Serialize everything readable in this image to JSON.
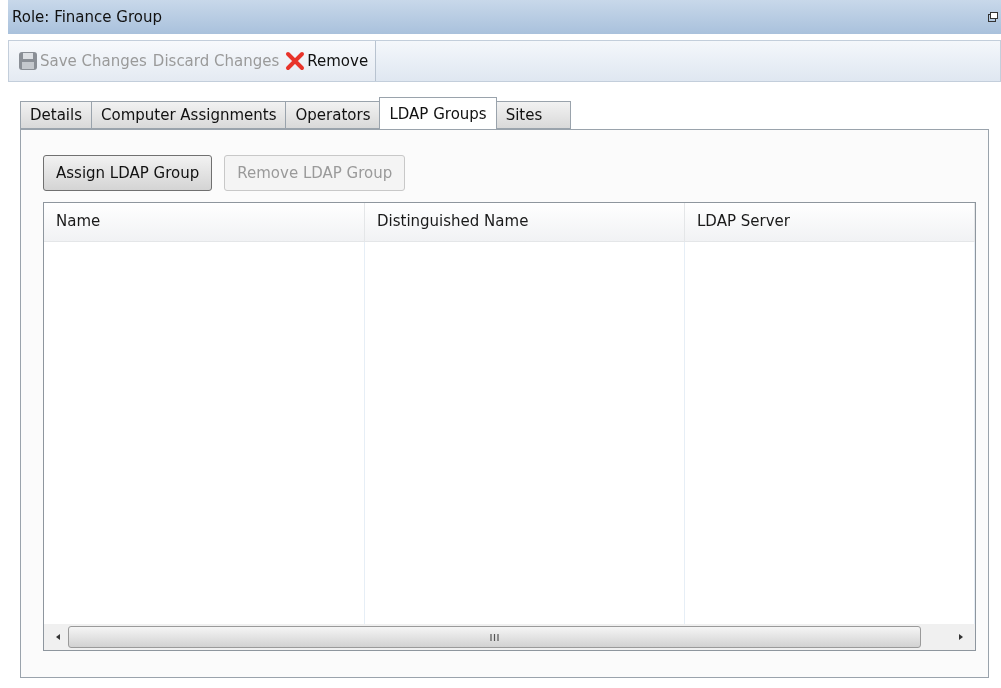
{
  "window": {
    "title": "Role: Finance Group"
  },
  "toolbar": [
    {
      "label": "Save Changes",
      "kind": "save",
      "disabled": true
    },
    {
      "label": "Discard Changes",
      "kind": "plain",
      "disabled": true
    },
    {
      "label": "Remove",
      "kind": "remove",
      "disabled": false
    }
  ],
  "tabs": [
    {
      "label": "Details",
      "selected": false
    },
    {
      "label": "Computer Assignments",
      "selected": false
    },
    {
      "label": "Operators",
      "selected": false
    },
    {
      "label": "LDAP Groups",
      "selected": true
    },
    {
      "label": "Sites",
      "selected": false
    }
  ],
  "buttons": [
    {
      "label": "Assign LDAP Group",
      "disabled": false
    },
    {
      "label": "Remove LDAP Group",
      "disabled": true
    }
  ],
  "table": {
    "columns": [
      "Name",
      "Distinguished Name",
      "LDAP Server"
    ]
  }
}
